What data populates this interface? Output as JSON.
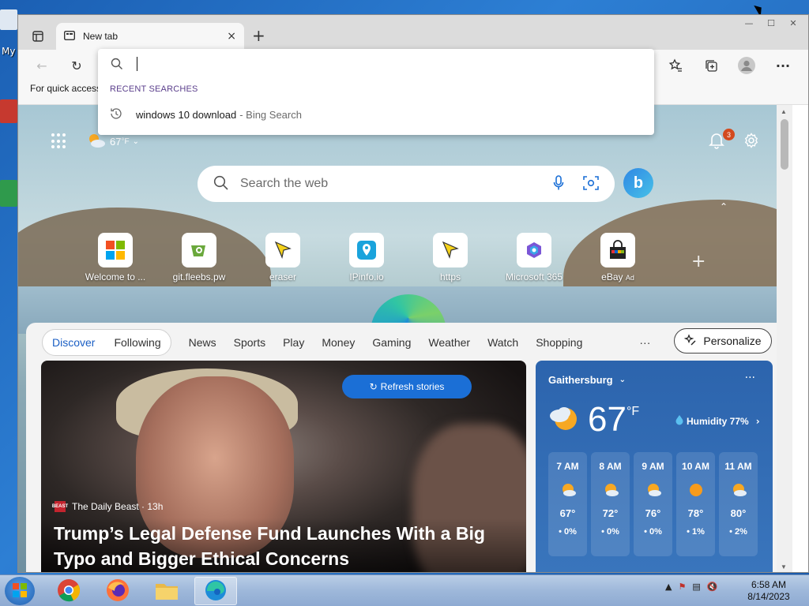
{
  "desktop": {
    "icon_label": "My"
  },
  "window": {
    "caption_buttons": [
      "—",
      "☐",
      "✕"
    ]
  },
  "tab": {
    "title": "New tab",
    "close_glyph": "×",
    "new_tab_glyph": "+"
  },
  "favorites_bar": {
    "text": "For quick access"
  },
  "address_dropdown": {
    "section_label": "RECENT SEARCHES",
    "recent": [
      {
        "query": "windows 10 download",
        "source": "- Bing Search"
      }
    ]
  },
  "newtab_page": {
    "weather_mini": "67",
    "weather_mini_unit": "°F",
    "notification_count": "3",
    "search_placeholder": "Search the web",
    "quick_links": [
      {
        "label": "Welcome to ...",
        "icon": "microsoft-logo"
      },
      {
        "label": "git.fleebs.pw",
        "icon": "git-icon"
      },
      {
        "label": "eraser",
        "icon": "cursor-icon"
      },
      {
        "label": "IPinfo.io",
        "icon": "location-pin-icon"
      },
      {
        "label": "https",
        "icon": "cursor-icon"
      },
      {
        "label": "Microsoft 365",
        "icon": "m365-icon"
      },
      {
        "label": "eBay",
        "ad": "Ad",
        "icon": "shopping-bag-icon"
      }
    ]
  },
  "feed": {
    "tabs": [
      "Discover",
      "Following"
    ],
    "nav": [
      "News",
      "Sports",
      "Play",
      "Money",
      "Gaming",
      "Weather",
      "Watch",
      "Shopping"
    ],
    "more": "···",
    "personalize": "Personalize",
    "refresh": "Refresh stories",
    "hero": {
      "source": "The Daily Beast · 13h",
      "source_logo": "BEAST",
      "headline": "Trump’s Legal Defense Fund Launches With a Big Typo and Bigger Ethical Concerns"
    },
    "weather": {
      "city": "Gaithersburg",
      "temp": "67",
      "unit": "°F",
      "humidity": "Humidity 77%",
      "hourly": [
        {
          "time": "7 AM",
          "temp": "67°",
          "rain": "0%"
        },
        {
          "time": "8 AM",
          "temp": "72°",
          "rain": "0%"
        },
        {
          "time": "9 AM",
          "temp": "76°",
          "rain": "0%"
        },
        {
          "time": "10 AM",
          "temp": "78°",
          "rain": "1%"
        },
        {
          "time": "11 AM",
          "temp": "80°",
          "rain": "2%"
        }
      ]
    }
  },
  "taskbar": {
    "apps": [
      "chrome-icon",
      "firefox-icon",
      "file-explorer-icon",
      "edge-icon"
    ],
    "time": "6:58 AM",
    "date": "8/14/2023"
  },
  "colors": {
    "accent": "#1b6fd6",
    "weather_card": "#2c64ad",
    "taskbar": "#9eb8da"
  }
}
